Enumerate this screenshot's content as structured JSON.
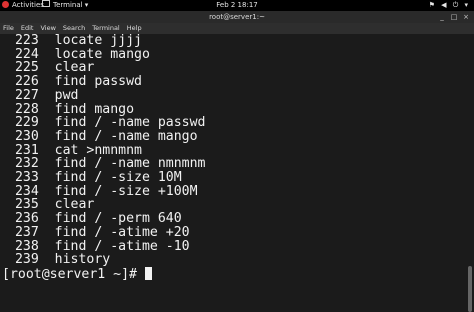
{
  "topbar": {
    "activities": "Activities",
    "app_name": "Terminal ▾",
    "clock": "Feb 2  18:17",
    "system_icons": "⚑ ◀ ⏻ ▾"
  },
  "window": {
    "title": "root@server1:~",
    "controls": [
      "_",
      "□",
      "×"
    ]
  },
  "menu": [
    "File",
    "Edit",
    "View",
    "Search",
    "Terminal",
    "Help"
  ],
  "terminal": {
    "lines": [
      " 223  locate jjjj",
      " 224  locate mango",
      " 225  clear",
      " 226  find passwd",
      " 227  pwd",
      " 228  find mango",
      " 229  find / -name passwd",
      " 230  find / -name mango",
      " 231  cat >nmnmnm",
      " 232  find / -name nmnmnm",
      " 233  find / -size 10M",
      " 234  find / -size +100M",
      " 235  clear",
      " 236  find / -perm 640",
      " 237  find / -atime +20",
      " 238  find / -atime -10",
      " 239  history"
    ],
    "prompt": "[root@server1 ~]# "
  }
}
